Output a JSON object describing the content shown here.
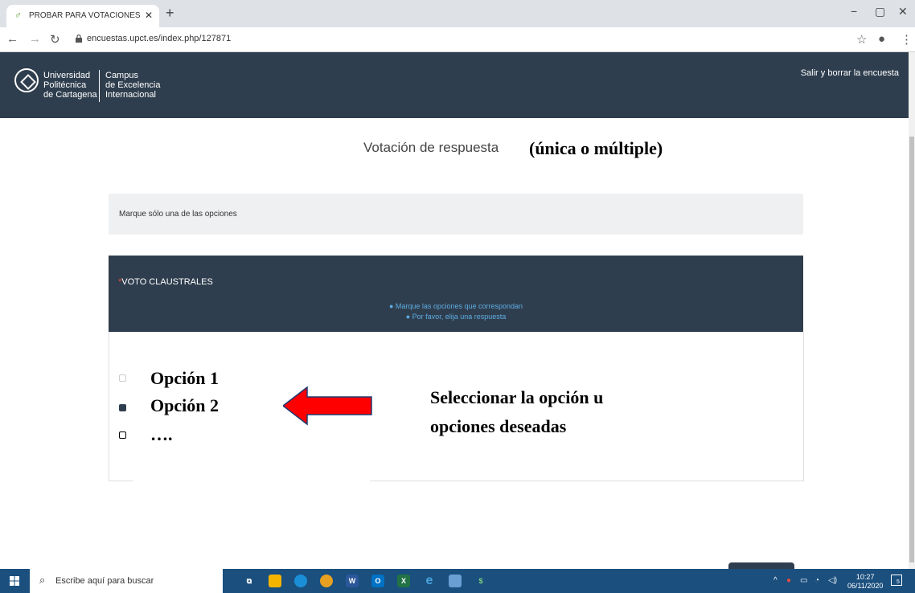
{
  "browser": {
    "tab_title": "PROBAR PARA VOTACIONES CLA",
    "url": "encuestas.upct.es/index.php/127871"
  },
  "header": {
    "logo_line1": "Universidad",
    "logo_line2": "Politécnica",
    "logo_line3": "de Cartagena",
    "campus_line1": "Campus",
    "campus_line2": "de Excelencia",
    "campus_line3": "Internacional",
    "exit_label": "Salir y borrar la encuesta"
  },
  "page": {
    "heading": "Votación de respuesta",
    "heading_annotation": "(única o múltiple)",
    "help_text": "Marque sólo una de las opciones"
  },
  "question": {
    "required_mark": "*",
    "title": "VOTO CLAUSTRALES",
    "tip1": "Marque las opciones que correspondan",
    "tip2": "Por favor, elija una respuesta"
  },
  "options": [
    {
      "label": "Opción 1",
      "checked": false
    },
    {
      "label": "Opción 2",
      "checked": true
    },
    {
      "label": "….",
      "checked": false
    }
  ],
  "annotation": {
    "line1": "Seleccionar la opción u",
    "line2": "opciones deseadas",
    "arrow_color": "#ff0000"
  },
  "taskbar": {
    "search_placeholder": "Escribe aquí para buscar",
    "time": "10:27",
    "date": "06/11/2020",
    "notification_count": "5"
  }
}
